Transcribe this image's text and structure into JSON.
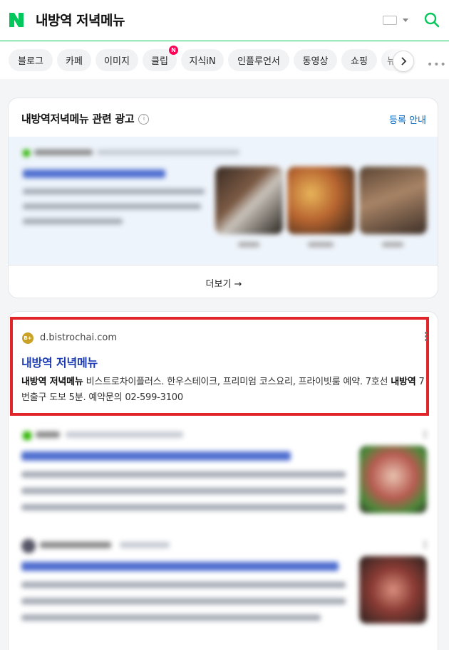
{
  "header": {
    "logo": "N",
    "query": "내방역 저녁메뉴"
  },
  "tabs": [
    {
      "label": "블로그"
    },
    {
      "label": "카페"
    },
    {
      "label": "이미지"
    },
    {
      "label": "클립",
      "badge": "N"
    },
    {
      "label": "지식iN"
    },
    {
      "label": "인플루언서"
    },
    {
      "label": "동영상"
    },
    {
      "label": "쇼핑"
    },
    {
      "label": "뉴"
    }
  ],
  "ad": {
    "title": "내방역저녁메뉴 관련 광고",
    "info_glyph": "i",
    "register_link": "등록 안내",
    "more": "더보기 →"
  },
  "result": {
    "favicon_text": "B+",
    "domain": "d.bistrochai.com",
    "title": "내방역 저녁메뉴",
    "desc_kw1": "내방역 저녁메뉴",
    "desc_part1": " 비스트로차이플러스. 한우스테이크, 프리미엄 코스요리, 프라이빗룸 예약. 7호선 ",
    "desc_kw2": "내방역",
    "desc_part2": " 7번출구 도보 5분. 예약문의 02-599-3100"
  },
  "colors": {
    "brand_green": "#03c75a",
    "link_blue": "#1a3bb5",
    "highlight_red": "#e0242a"
  }
}
